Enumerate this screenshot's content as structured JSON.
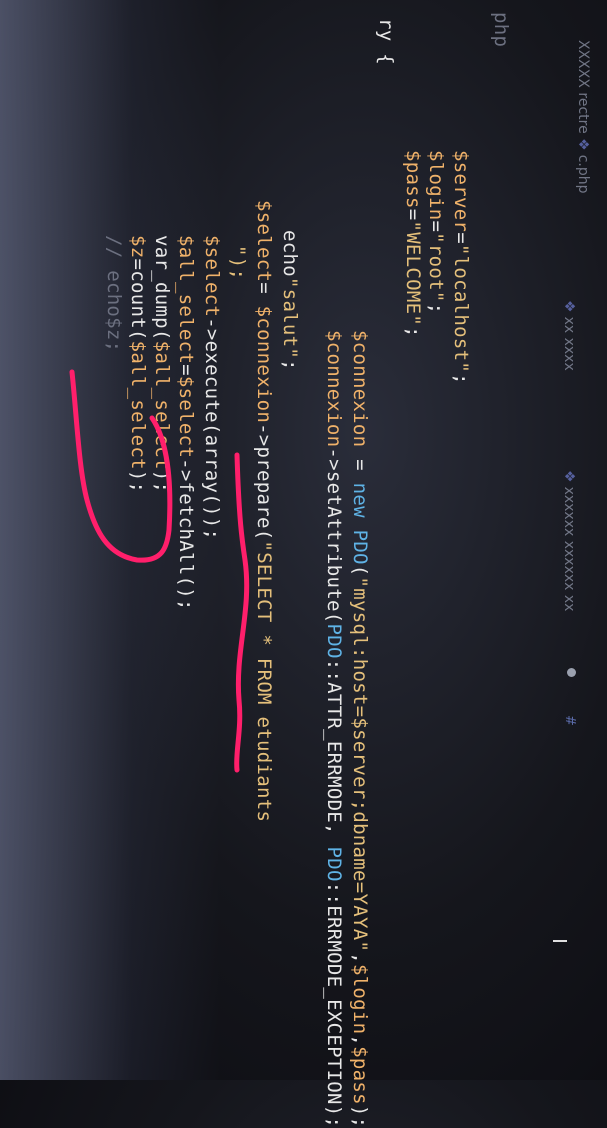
{
  "tabs": {
    "breadcrumb_folder": "XXXXX rectre",
    "file_name": "c.php",
    "tab_two": "xx xxxx",
    "tab_three": "xxxxxx xxxxxx xx"
  },
  "editor": {
    "lines": [
      {
        "pre": "php",
        "text": ""
      },
      {
        "pre": "",
        "text": ""
      },
      {
        "pre": "    ",
        "parts": [
          [
            "$server",
            "v"
          ],
          [
            "=",
            "vw"
          ],
          [
            "\"localhost\"",
            "s"
          ],
          [
            ";",
            "vw"
          ]
        ]
      },
      {
        "pre": "    ",
        "parts": [
          [
            "$login",
            "v"
          ],
          [
            "=",
            "vw"
          ],
          [
            "\"root\"",
            "s"
          ],
          [
            ";",
            "vw"
          ]
        ]
      },
      {
        "pre": "    ",
        "parts": [
          [
            "$pass",
            "v"
          ],
          [
            "=",
            "vw"
          ],
          [
            "\"WELCOME\"",
            "s"
          ],
          [
            ";",
            "vw"
          ]
        ]
      },
      {
        "pre": "",
        "parts": [
          [
            "ry {",
            "vw"
          ]
        ]
      },
      {
        "pre": "  ",
        "parts": [
          [
            "$connexion",
            "v"
          ],
          [
            " = ",
            "vw"
          ],
          [
            "new",
            "k"
          ],
          [
            " ",
            "vw"
          ],
          [
            "PDO",
            "k"
          ],
          [
            "(",
            "vw"
          ],
          [
            "\"mysql:host=$server;dbname=YAYA\"",
            "s"
          ],
          [
            ",",
            "vw"
          ],
          [
            "$login",
            "v"
          ],
          [
            ",",
            "vw"
          ],
          [
            "$pass",
            "v"
          ],
          [
            ");",
            "vw"
          ]
        ]
      },
      {
        "pre": "  ",
        "parts": [
          [
            "$connexion",
            "v"
          ],
          [
            "->setAttribute(",
            "vw"
          ],
          [
            "PDO",
            "k"
          ],
          [
            "::ATTR_ERRMODE, ",
            "vw"
          ],
          [
            "PDO",
            "k"
          ],
          [
            "::ERRMODE_EXCEPTION);",
            "vw"
          ]
        ]
      },
      {
        "pre": "",
        "text": ""
      },
      {
        "pre": "",
        "parts": [
          [
            "echo",
            "vw"
          ],
          [
            "\"salut\"",
            "s"
          ],
          [
            ";",
            "vw"
          ]
        ]
      },
      {
        "pre": "",
        "parts": [
          [
            "$select",
            "v"
          ],
          [
            "= ",
            "vw"
          ],
          [
            "$connexion",
            "v"
          ],
          [
            "->prepare(",
            "vw"
          ],
          [
            "\"SELECT * FROM etudiants",
            "s"
          ]
        ]
      },
      {
        "pre": "  ",
        "parts": [
          [
            "\");",
            "s"
          ]
        ]
      },
      {
        "pre": "",
        "parts": [
          [
            "$select",
            "v"
          ],
          [
            "->execute(array());",
            "vw"
          ]
        ]
      },
      {
        "pre": "",
        "parts": [
          [
            "$all_select",
            "v"
          ],
          [
            "=",
            "vw"
          ],
          [
            "$select",
            "v"
          ],
          [
            "->fetchAll();",
            "vw"
          ]
        ]
      },
      {
        "pre": "",
        "parts": [
          [
            "var_dump(",
            "vw"
          ],
          [
            "$all_select",
            "v"
          ],
          [
            ");",
            "vw"
          ]
        ]
      },
      {
        "pre": "",
        "parts": [
          [
            "$z",
            "v"
          ],
          [
            "=count(",
            "vw"
          ],
          [
            "$all_select",
            "v"
          ],
          [
            ");",
            "vw"
          ]
        ]
      },
      {
        "pre": "",
        "parts": [
          [
            "// echo$z;",
            "dim"
          ]
        ]
      }
    ]
  },
  "colors": {
    "background": "#15161c",
    "variable": "#f0b26a",
    "string": "#e5c07b",
    "keyword": "#5fb3e6",
    "annotation": "#ff1f6b"
  },
  "icons": [
    "php-file-icon",
    "cursor-icon"
  ]
}
